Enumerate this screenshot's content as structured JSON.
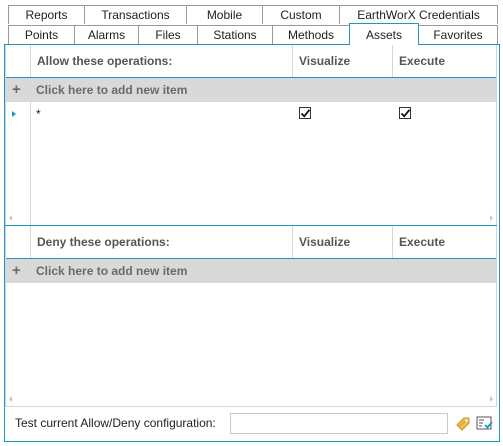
{
  "tabs_row1": [
    "Reports",
    "Transactions",
    "Mobile",
    "Custom",
    "EarthWorX Credentials"
  ],
  "tabs_row2": [
    "Points",
    "Alarms",
    "Files",
    "Stations",
    "Methods",
    "Assets",
    "Favorites"
  ],
  "active_tab": "Assets",
  "allow_grid": {
    "headers": [
      "Allow these operations:",
      "Visualize",
      "Execute"
    ],
    "add_label": "Click here to add new item",
    "rows": [
      {
        "operation": "*",
        "visualize": true,
        "execute": true
      }
    ]
  },
  "deny_grid": {
    "headers": [
      "Deny these operations:",
      "Visualize",
      "Execute"
    ],
    "add_label": "Click here to add new item"
  },
  "footer": {
    "label": "Test current Allow/Deny configuration:",
    "input_value": "",
    "icons": [
      "tag-icon",
      "check-list-icon"
    ]
  },
  "colors": {
    "accent": "#1c97c8",
    "add_row_bg": "#d9d9d9"
  }
}
